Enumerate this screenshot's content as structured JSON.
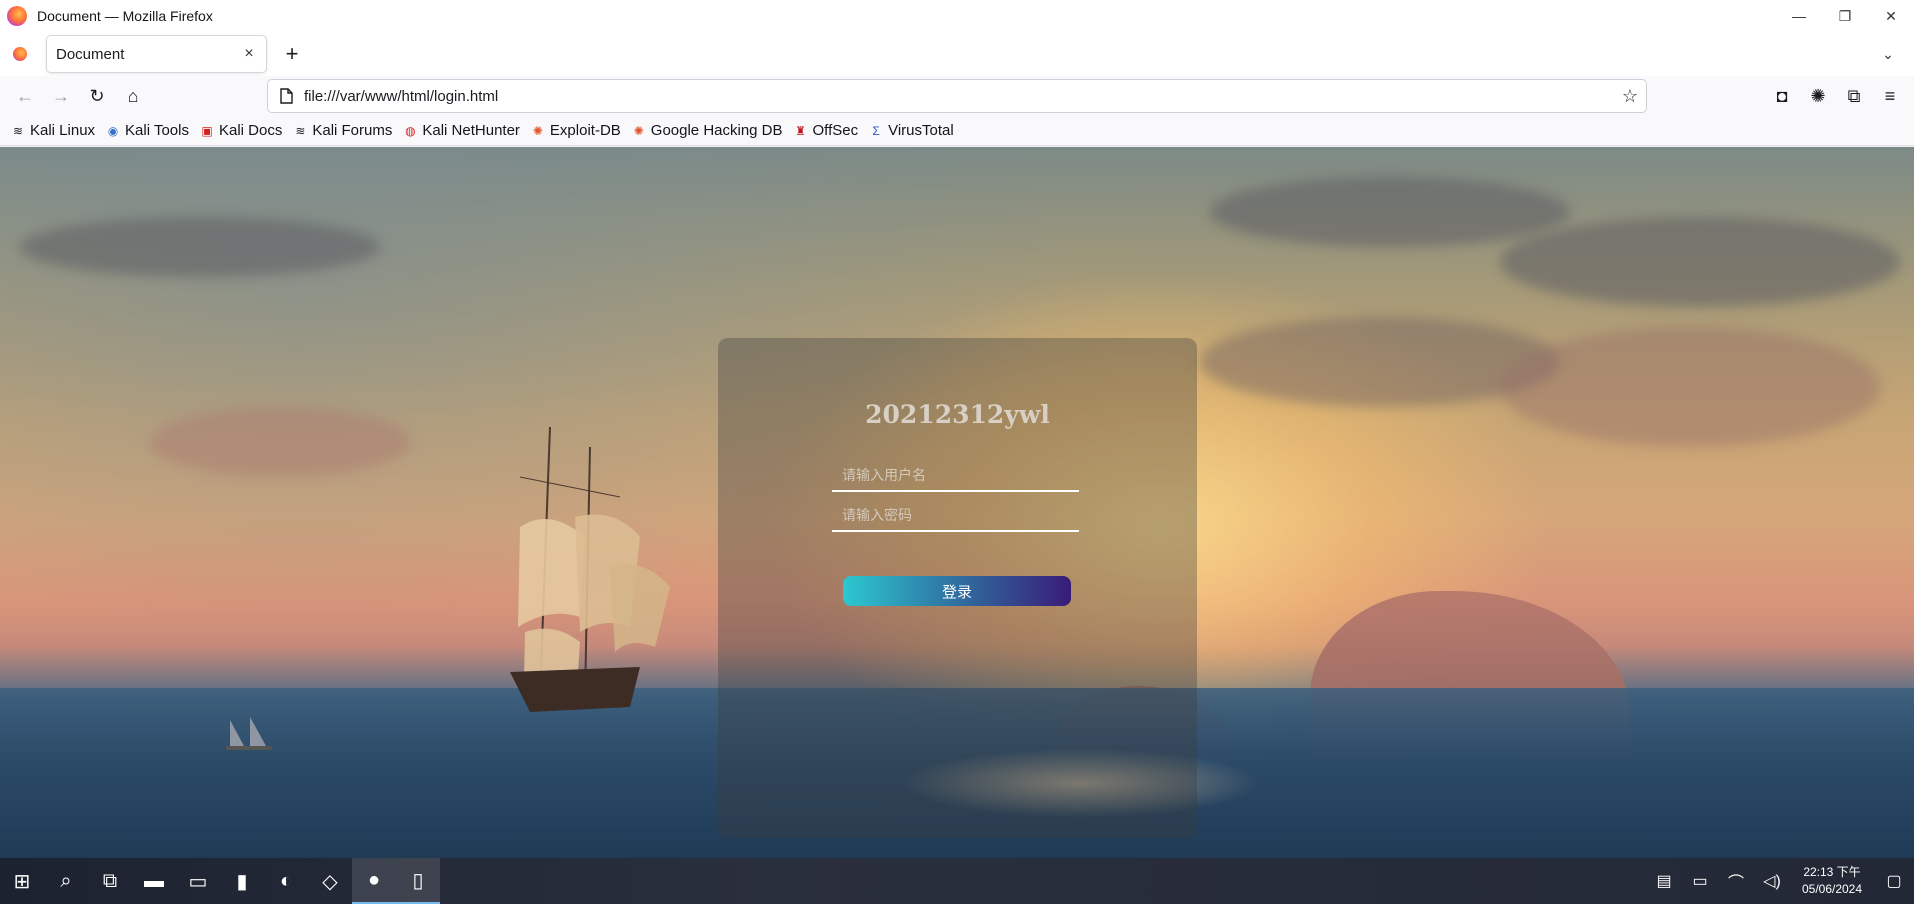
{
  "window": {
    "title": "Document — Mozilla Firefox",
    "minimize": "—",
    "restore": "❐",
    "close": "✕"
  },
  "tabs": [
    {
      "label": "Document",
      "close": "×"
    }
  ],
  "tabbar": {
    "new_tab": "+",
    "list_all": "⌄"
  },
  "navbar": {
    "back": "←",
    "forward": "→",
    "reload": "↻",
    "home": "⌂",
    "url": "file:///var/www/html/login.html",
    "bookmark_star": "☆",
    "pocket": "◘",
    "account": "✺",
    "extensions": "⧉",
    "menu": "≡"
  },
  "bookmarks": [
    {
      "label": "Kali Linux",
      "icon": "kali-dragon-icon",
      "glyph": "≋",
      "color": "#1c1b22"
    },
    {
      "label": "Kali Tools",
      "icon": "kali-tools-icon",
      "glyph": "◉",
      "color": "#3870c9"
    },
    {
      "label": "Kali Docs",
      "icon": "kali-docs-icon",
      "glyph": "▣",
      "color": "#d0211c"
    },
    {
      "label": "Kali Forums",
      "icon": "kali-forums-icon",
      "glyph": "≋",
      "color": "#1c1b22"
    },
    {
      "label": "Kali NetHunter",
      "icon": "kali-nethunter-icon",
      "glyph": "◍",
      "color": "#d0211c"
    },
    {
      "label": "Exploit-DB",
      "icon": "exploit-db-icon",
      "glyph": "✺",
      "color": "#e2542c"
    },
    {
      "label": "Google Hacking DB",
      "icon": "google-hacking-db-icon",
      "glyph": "✺",
      "color": "#e2542c"
    },
    {
      "label": "OffSec",
      "icon": "offsec-icon",
      "glyph": "♜",
      "color": "#c0161f"
    },
    {
      "label": "VirusTotal",
      "icon": "virustotal-icon",
      "glyph": "Σ",
      "color": "#3855c5"
    }
  ],
  "login": {
    "title": "20212312ywl",
    "username_placeholder": "请输入用户名",
    "password_placeholder": "请输入密码",
    "submit_label": "登录"
  },
  "taskbar": {
    "apps": [
      {
        "name": "start-icon",
        "glyph": "⊞",
        "active": false
      },
      {
        "name": "search-icon",
        "glyph": "⌕",
        "active": false
      },
      {
        "name": "task-view-icon",
        "glyph": "⧉",
        "active": false
      },
      {
        "name": "file-manager-icon",
        "glyph": "▬",
        "active": false
      },
      {
        "name": "folder-icon",
        "glyph": "▭",
        "active": false
      },
      {
        "name": "terminal-icon",
        "glyph": "▮",
        "active": false
      },
      {
        "name": "edge-icon",
        "glyph": "◐",
        "active": false
      },
      {
        "name": "notepad-icon",
        "glyph": "◇",
        "active": false
      },
      {
        "name": "firefox-icon",
        "glyph": "●",
        "active": true
      },
      {
        "name": "sticky-notes-icon",
        "glyph": "▯",
        "active": true
      }
    ],
    "tray": [
      {
        "name": "clipboard-icon",
        "glyph": "▤"
      },
      {
        "name": "display-icon",
        "glyph": "▭"
      },
      {
        "name": "network-icon",
        "glyph": "⌒"
      },
      {
        "name": "volume-icon",
        "glyph": "◁)"
      }
    ],
    "time": "22:13 下午",
    "date": "05/06/2024",
    "notifications": "▢"
  },
  "colors": {
    "button_gradient_start": "#2cc8d0",
    "button_gradient_end": "#3a1b78",
    "taskbar_bg": "#1c2230"
  }
}
